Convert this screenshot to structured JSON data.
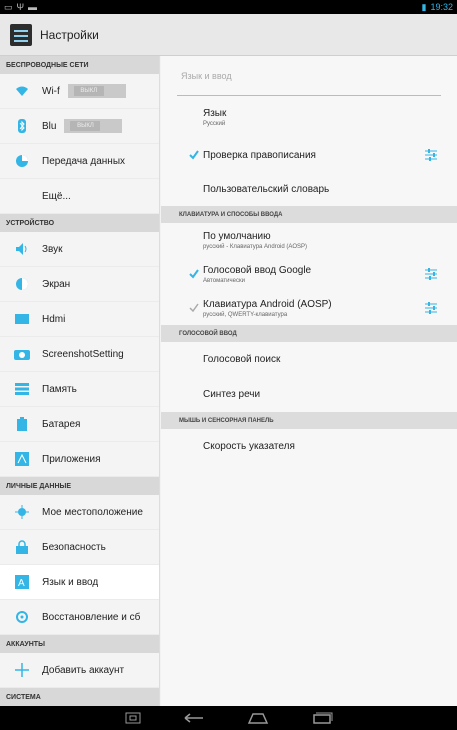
{
  "status": {
    "time": "19:32",
    "battery_icon": "battery-icon"
  },
  "app": {
    "title": "Настройки"
  },
  "sidebar": {
    "sections": [
      {
        "header": "БЕСПРОВОДНЫЕ СЕТИ"
      },
      {
        "header": "УСТРОЙСТВО"
      },
      {
        "header": "ЛИЧНЫЕ ДАННЫЕ"
      },
      {
        "header": "АККАУНТЫ"
      },
      {
        "header": "СИСТЕМА"
      }
    ],
    "items": [
      {
        "label": "Wi-f",
        "toggle": "ВЫКЛ"
      },
      {
        "label": "Blu",
        "toggle": "ВЫКЛ"
      },
      {
        "label": "Передача данных"
      },
      {
        "label": "Ещё..."
      },
      {
        "label": "Звук"
      },
      {
        "label": "Экран"
      },
      {
        "label": "Hdmi"
      },
      {
        "label": "ScreenshotSetting"
      },
      {
        "label": "Память"
      },
      {
        "label": "Батарея"
      },
      {
        "label": "Приложения"
      },
      {
        "label": "Мое местоположение"
      },
      {
        "label": "Безопасность"
      },
      {
        "label": "Язык и ввод"
      },
      {
        "label": "Восстановление и сб"
      },
      {
        "label": "Добавить аккаунт"
      }
    ]
  },
  "main": {
    "title": "Язык и ввод",
    "language": {
      "title": "Язык",
      "subtitle": "Русский"
    },
    "spellcheck": {
      "title": "Проверка правописания",
      "checked": true
    },
    "user_dict": {
      "title": "Пользовательский словарь"
    },
    "kbd_header": "КЛАВИАТУРА И СПОСОБЫ ВВОДА",
    "default": {
      "title": "По умолчанию",
      "subtitle": "русский - Клавиатура Android (AOSP)"
    },
    "google_voice": {
      "title": "Голосовой ввод Google",
      "subtitle": "Автоматически",
      "checked": true
    },
    "aosp": {
      "title": "Клавиатура Android (AOSP)",
      "subtitle": "русский, QWERTY-клавиатура",
      "checked": true
    },
    "voice_header": "ГОЛОСОВОЙ ВВОД",
    "voice_search": {
      "title": "Голосовой поиск"
    },
    "tts": {
      "title": "Синтез речи"
    },
    "mouse_header": "МЫШЬ И СЕНСОРНАЯ ПАНЕЛЬ",
    "pointer": {
      "title": "Скорость указателя"
    }
  },
  "colors": {
    "accent": "#33b5e5"
  }
}
